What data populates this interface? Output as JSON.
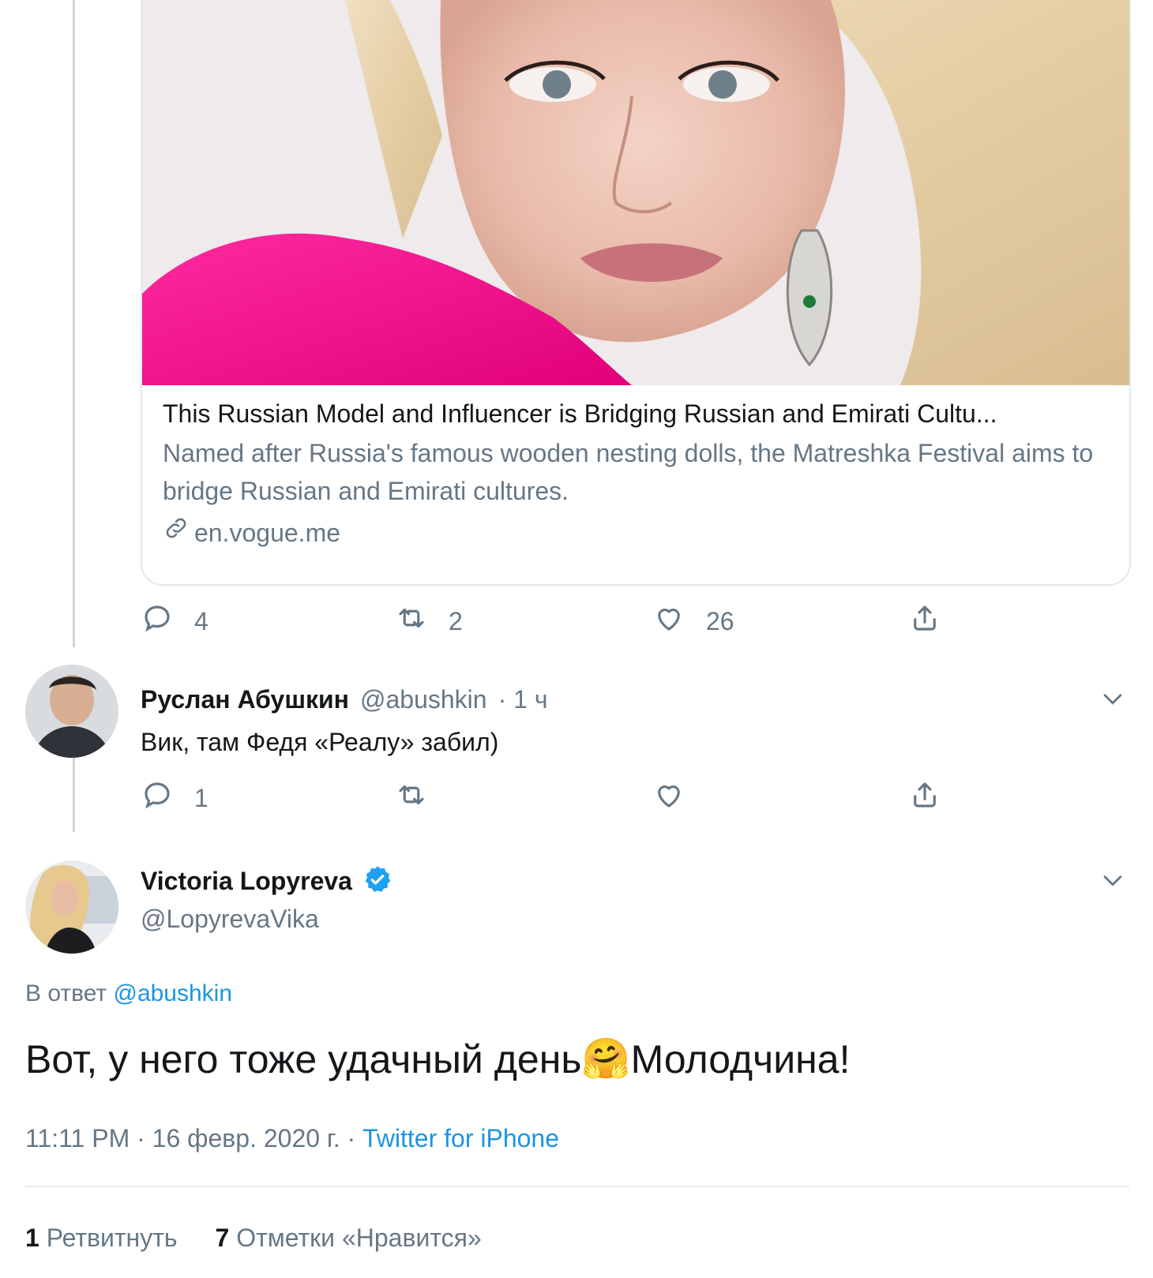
{
  "card": {
    "title": "This Russian Model and Influencer is Bridging Russian and Emirati Cultu...",
    "description": "Named after Russia's famous wooden nesting dolls, the Matreshka Festival aims to bridge Russian and Emirati cultures.",
    "domain": "en.vogue.me",
    "link_icon": "link-icon"
  },
  "tweet_actions": {
    "reply_count": "4",
    "retweet_count": "2",
    "like_count": "26"
  },
  "reply_tweet": {
    "name": "Руслан Абушкин",
    "handle": "@abushkin",
    "time": "· 1 ч",
    "text": "Вик, там Федя «Реалу» забил)",
    "reply_count": "1"
  },
  "main_tweet": {
    "name": "Victoria Lopyreva",
    "handle": "@LopyrevaVika",
    "verified_icon": "verified-badge-icon",
    "reply_prefix": "В ответ",
    "reply_to": "@abushkin",
    "text_before": "Вот, у него тоже удачный день",
    "emoji": "🤗",
    "text_after": "Молодчина!",
    "time": "11:11 PM · 16 февр. 2020 г. ·",
    "source": "Twitter for iPhone",
    "retweets_count": "1",
    "retweets_label": "Ретвитнуть",
    "likes_count": "7",
    "likes_label": "Отметки «Нравится»"
  },
  "colors": {
    "text": "#14171a",
    "secondary": "#657786",
    "link": "#1b95e0",
    "border": "#e1e8ed",
    "verified": "#1da1f2"
  }
}
